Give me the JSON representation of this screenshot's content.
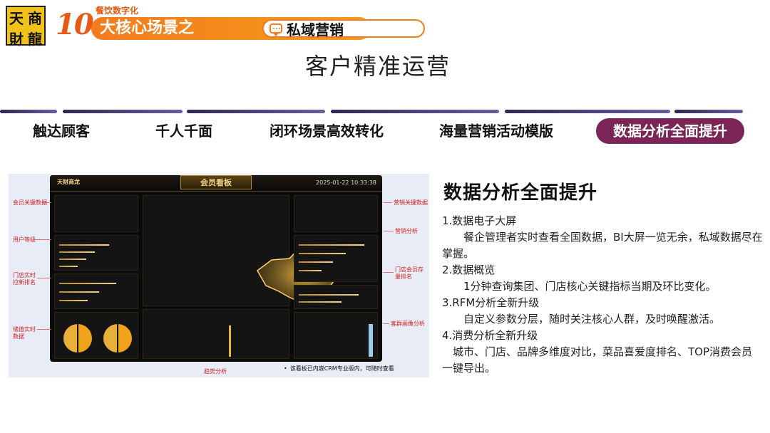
{
  "logo": {
    "chars": [
      "天",
      "商",
      "財",
      "龍"
    ]
  },
  "banner": {
    "tag": "餐饮数字化",
    "number": "10",
    "main_text": "大核心场景之",
    "inner_text": "私域营销",
    "colors": {
      "orange": "#f57b1e",
      "accent": "#e85a12"
    }
  },
  "page_title": "客户精准运营",
  "tabs": [
    {
      "label": "触达顾客",
      "active": false
    },
    {
      "label": "千人千面",
      "active": false
    },
    {
      "label": "闭环场景高效转化",
      "active": false
    },
    {
      "label": "海量营销活动模版",
      "active": false
    },
    {
      "label": "数据分析全面提升",
      "active": true
    }
  ],
  "tab_active_color": "#7b2456",
  "dashboard": {
    "brand": "天财商龙",
    "title": "会员看板",
    "date": "2025-01-22  10:33:38",
    "callouts_left": [
      "会员关键数据",
      "用户等级",
      "门店实时拉新排名",
      "储值实时数据"
    ],
    "callouts_right": [
      "营销关键数据",
      "营销分析",
      "门店会员存量排名",
      "客群画像分析"
    ],
    "callout_bottom": "趋势分析",
    "note": "该看板已内嵌CRM专业版内，可随时查看"
  },
  "info": {
    "heading": "数据分析全面提升",
    "items": [
      {
        "title": "1.数据电子大屏",
        "body": "餐企管理者实时查看全国数据，BI大屏一览无余，私域数据尽在掌握。"
      },
      {
        "title": "2.数据概览",
        "body": "1分钟查询集团、门店核心关键指标当期及环比变化。"
      },
      {
        "title": "3.RFM分析全新升级",
        "body": "自定义参数分层，随时关注核心人群，及时唤醒激活。"
      },
      {
        "title": "4.消费分析全新升级",
        "body": "城市、门店、品牌多维度对比，菜品喜爱度排名、TOP消费会员一键导出。"
      }
    ]
  }
}
